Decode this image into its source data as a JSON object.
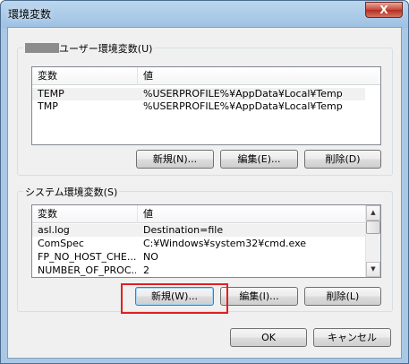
{
  "window": {
    "title": "環境変数",
    "close_label": "X"
  },
  "user_vars": {
    "label": "ユーザー環境変数(U)",
    "col_name": "変数",
    "col_value": "値",
    "rows": [
      {
        "name": "TEMP",
        "value": "%USERPROFILE%¥AppData¥Local¥Temp"
      },
      {
        "name": "TMP",
        "value": "%USERPROFILE%¥AppData¥Local¥Temp"
      }
    ],
    "new_label": "新規(N)...",
    "edit_label": "編集(E)...",
    "delete_label": "削除(D)"
  },
  "system_vars": {
    "label": "システム環境変数(S)",
    "col_name": "変数",
    "col_value": "値",
    "rows": [
      {
        "name": "asl.log",
        "value": "Destination=file"
      },
      {
        "name": "ComSpec",
        "value": "C:¥Windows¥system32¥cmd.exe"
      },
      {
        "name": "FP_NO_HOST_CHE...",
        "value": "NO"
      },
      {
        "name": "NUMBER_OF_PROC...",
        "value": "2"
      }
    ],
    "new_label": "新規(W)...",
    "edit_label": "編集(I)...",
    "delete_label": "削除(L)"
  },
  "footer": {
    "ok_label": "OK",
    "cancel_label": "キャンセル"
  },
  "scroll": {
    "up_arrow": "▲",
    "down_arrow": "▼"
  },
  "colors": {
    "highlight": "#e02020",
    "selection": "#f1f1f1"
  }
}
